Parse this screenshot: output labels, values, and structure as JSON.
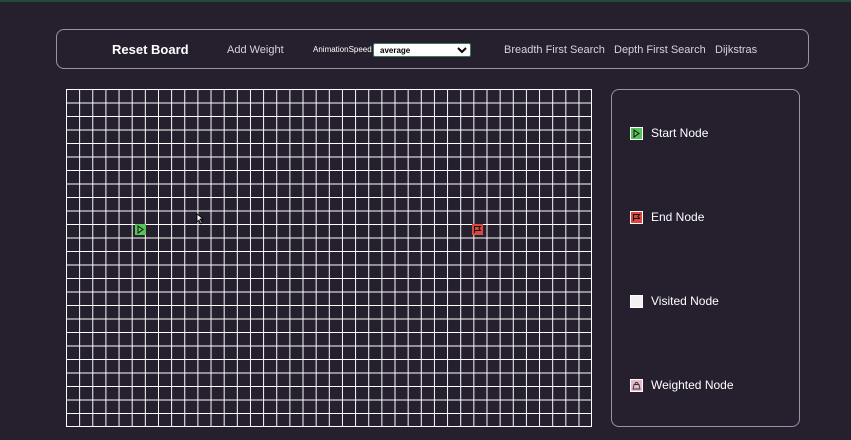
{
  "navbar": {
    "title": "Reset Board",
    "add_weight": "Add Weight",
    "speed_label": "AnimationSpeed",
    "speed_value": "average",
    "algorithms": [
      "Breadth First Search",
      "Depth First Search",
      "Dijkstras"
    ]
  },
  "grid": {
    "start_icon": "play-icon",
    "end_icon": "flag-icon"
  },
  "legend": {
    "items": [
      {
        "label": "Start Node",
        "color": "#56c25a",
        "icon": "play-icon"
      },
      {
        "label": "End Node",
        "color": "#d9473f",
        "icon": "flag-icon"
      },
      {
        "label": "Visited Node",
        "color": "#f2f2f2",
        "icon": ""
      },
      {
        "label": "Weighted Node",
        "color": "#e8b9c9",
        "icon": "weight-icon"
      }
    ]
  },
  "colors": {
    "background": "#251f2e",
    "border": "#9a93a6",
    "start": "#56c25a",
    "end": "#d9473f"
  }
}
